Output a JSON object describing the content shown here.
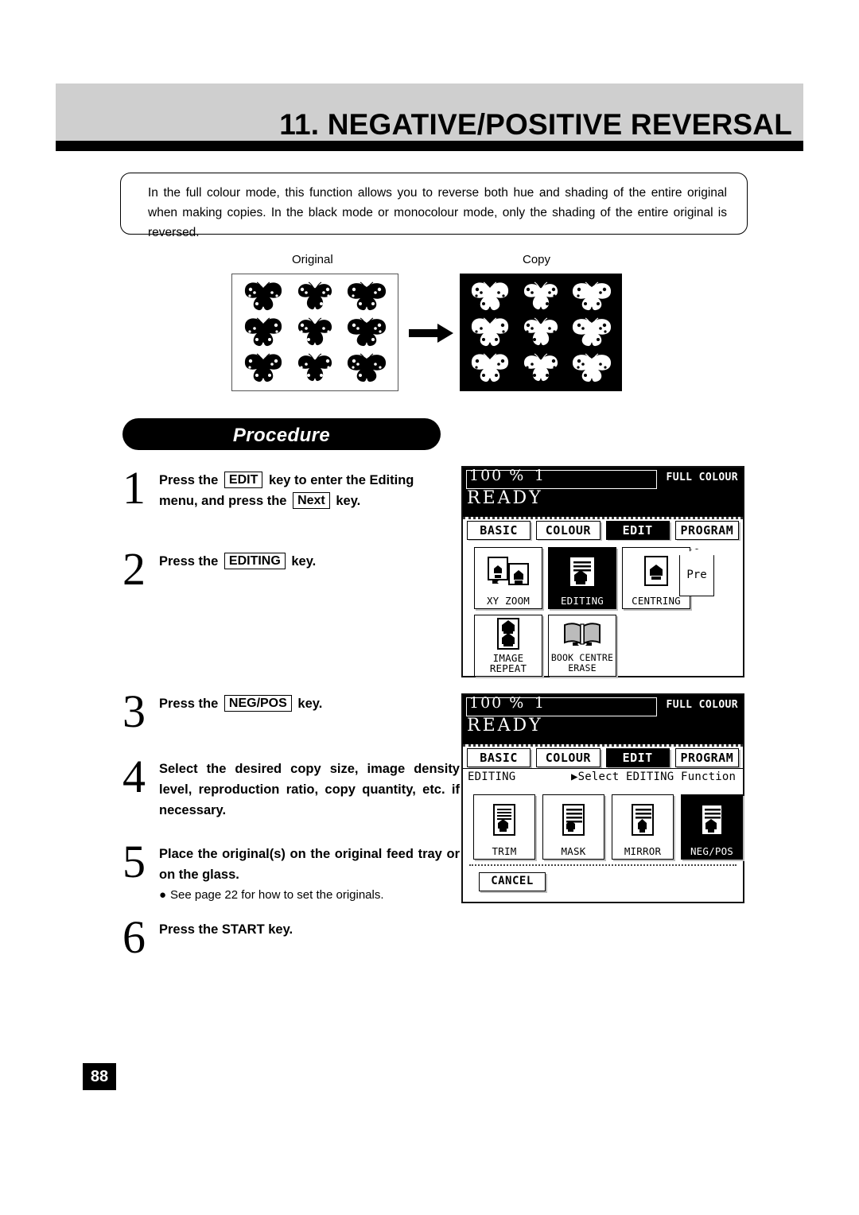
{
  "header": {
    "title": "11. NEGATIVE/POSITIVE REVERSAL"
  },
  "intro": {
    "text": "In the full colour mode, this function allows you to reverse both hue and shading of the entire original when making copies. In the black mode or monocolour mode, only the shading of the entire original is reversed."
  },
  "samples": {
    "original_label": "Original",
    "copy_label": "Copy",
    "arrow_icon": "right-arrow-icon"
  },
  "procedure": {
    "title": "Procedure",
    "steps": [
      {
        "number": "1",
        "line1_pre": "Press the",
        "key1": "EDIT",
        "line1_post": "key to enter the Editing",
        "line2_pre": "menu, and press the",
        "key2": "Next",
        "line2_post": "key."
      },
      {
        "number": "2",
        "line1_pre": "Press the",
        "key1": "EDITING",
        "line1_post": "key."
      },
      {
        "number": "3",
        "line1_pre": "Press the",
        "key1": "NEG/POS",
        "line1_post": "key."
      },
      {
        "number": "4",
        "paragraph": "Select the desired copy size, image density level, reproduction ratio, copy quantity, etc. if necessary."
      },
      {
        "number": "5",
        "paragraph": "Place the original(s) on the original feed tray or on the glass.",
        "note": "See page 22 for how to set the originals."
      },
      {
        "number": "6",
        "line1_pre": "Press the START key."
      }
    ]
  },
  "lcd_panel_1": {
    "ratio": "100 %",
    "copy_count": "1",
    "colour_mode": "FULL COLOUR",
    "status": "READY",
    "tabs": [
      {
        "label": "BASIC",
        "selected": false
      },
      {
        "label": "COLOUR",
        "selected": false
      },
      {
        "label": "EDIT",
        "selected": true
      },
      {
        "label": "PROGRAM",
        "selected": false
      }
    ],
    "functions": [
      {
        "label": "XY ZOOM",
        "selected": false,
        "icon": "xy-zoom-icon"
      },
      {
        "label": "EDITING",
        "selected": true,
        "icon": "editing-icon"
      },
      {
        "label": "CENTRING",
        "selected": false,
        "icon": "centring-icon"
      },
      {
        "label": "IMAGE REPEAT",
        "selected": false,
        "icon": "image-repeat-icon"
      },
      {
        "label": "BOOK CENTRE ERASE",
        "selected": false,
        "icon": "book-centre-erase-icon"
      }
    ],
    "preview_tab": "Pre"
  },
  "lcd_panel_2": {
    "ratio": "100 %",
    "copy_count": "1",
    "colour_mode": "FULL COLOUR",
    "status": "READY",
    "tabs": [
      {
        "label": "BASIC",
        "selected": false
      },
      {
        "label": "COLOUR",
        "selected": false
      },
      {
        "label": "EDIT",
        "selected": true
      },
      {
        "label": "PROGRAM",
        "selected": false
      }
    ],
    "status_mode": "EDITING",
    "status_prompt": "▶Select EDITING Function",
    "functions": [
      {
        "label": "TRIM",
        "selected": false,
        "icon": "trim-icon"
      },
      {
        "label": "MASK",
        "selected": false,
        "icon": "mask-icon"
      },
      {
        "label": "MIRROR",
        "selected": false,
        "icon": "mirror-icon"
      },
      {
        "label": "NEG/POS",
        "selected": true,
        "icon": "neg-pos-icon"
      }
    ],
    "cancel_label": "CANCEL"
  },
  "footer": {
    "page_number": "88"
  }
}
